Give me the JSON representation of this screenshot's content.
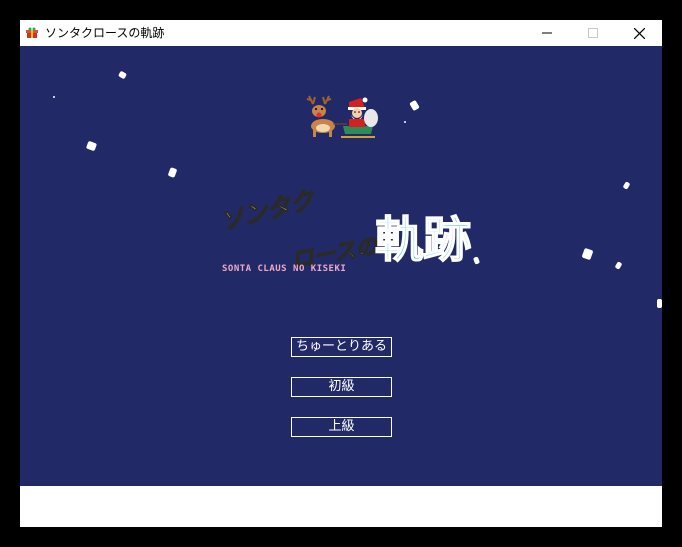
{
  "window": {
    "title": "ソンタクロースの軌跡"
  },
  "game": {
    "logo": {
      "line1": "ソンタク",
      "line2": "ロースの",
      "kanji": "軌跡"
    },
    "subtitle": "SONTA CLAUS NO KISEKI",
    "menu": [
      {
        "label": "ちゅーとりある"
      },
      {
        "label": "初級"
      },
      {
        "label": "上級"
      }
    ],
    "colors": {
      "background": "#212a67",
      "subtitle": "#f0a8c8",
      "kanji": "#38b8e8"
    }
  }
}
